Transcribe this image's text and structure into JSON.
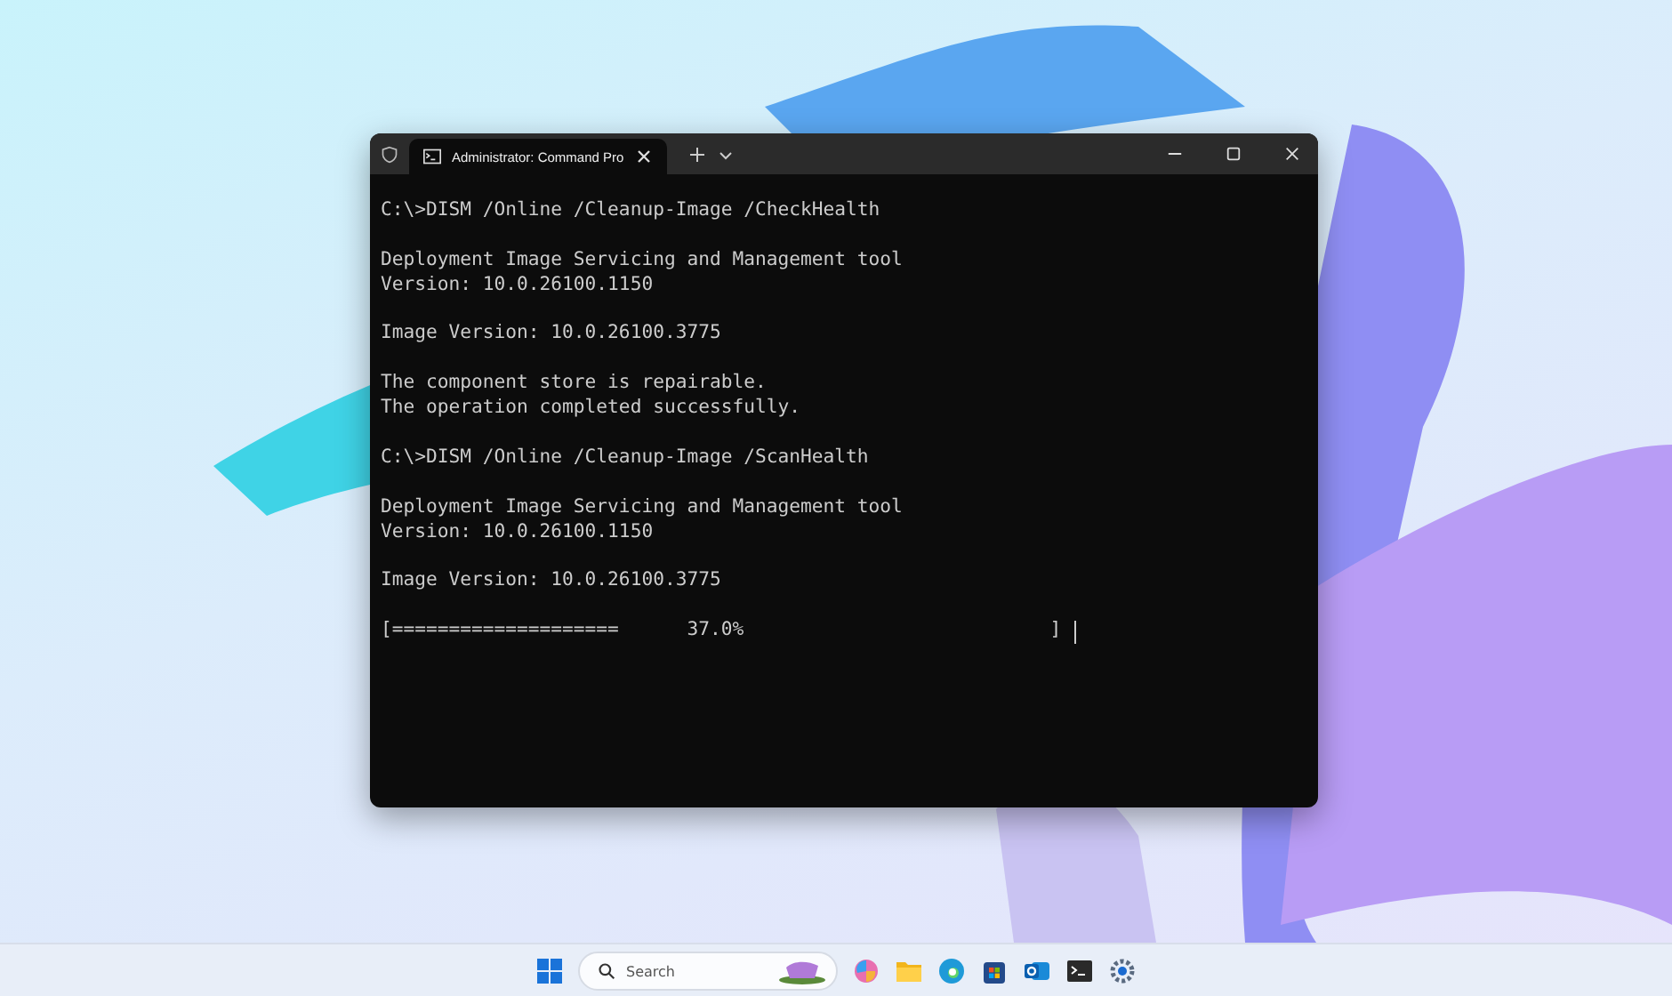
{
  "window": {
    "title": "Administrator: Command Pro"
  },
  "terminal": {
    "blocks": [
      [
        "C:\\>DISM /Online /Cleanup-Image /CheckHealth"
      ],
      [
        "Deployment Image Servicing and Management tool",
        "Version: 10.0.26100.1150"
      ],
      [
        "Image Version: 10.0.26100.3775"
      ],
      [
        "The component store is repairable.",
        "The operation completed successfully."
      ],
      [
        "C:\\>DISM /Online /Cleanup-Image /ScanHealth"
      ],
      [
        "Deployment Image Servicing and Management tool",
        "Version: 10.0.26100.1150"
      ],
      [
        "Image Version: 10.0.26100.3775"
      ],
      [
        "[====================      37.0%                           ]"
      ]
    ],
    "cursor": true
  },
  "taskbar": {
    "search": {
      "placeholder": "Search"
    }
  }
}
